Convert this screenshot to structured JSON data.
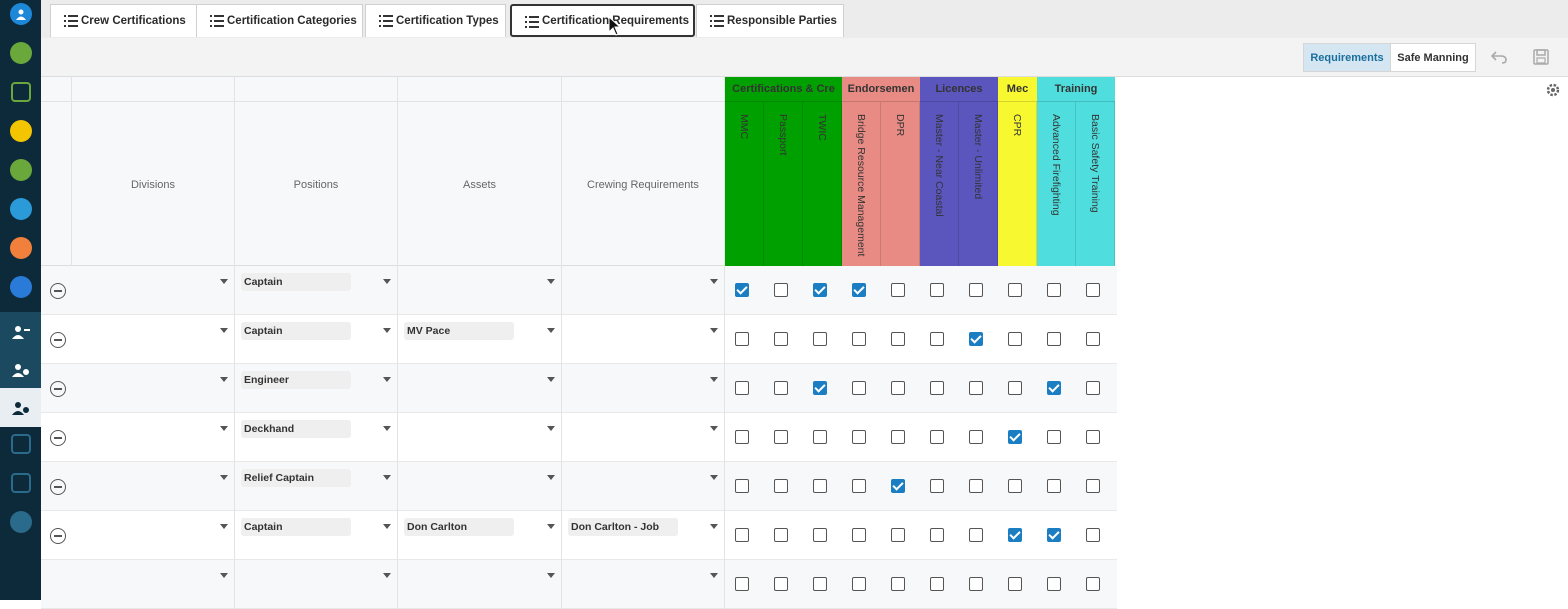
{
  "tabs": [
    {
      "label": "Crew Certifications"
    },
    {
      "label": "Certification Categories"
    },
    {
      "label": "Certification Types"
    },
    {
      "label": "Certification Requirements"
    },
    {
      "label": "Responsible Parties"
    }
  ],
  "toolbar": {
    "requirements_label": "Requirements",
    "safe_manning_label": "Safe Manning"
  },
  "columns": {
    "divisions": "Divisions",
    "positions": "Positions",
    "assets": "Assets",
    "crewing": "Crewing Requirements"
  },
  "groups": [
    {
      "title": "Certifications & Cre",
      "color": "#00a000",
      "items": [
        "MMC",
        "Passport",
        "TWIC"
      ]
    },
    {
      "title": "Endorsemen",
      "color": "#e98b85",
      "items": [
        "Bridge Resource Management",
        "DPR"
      ]
    },
    {
      "title": "Licences",
      "color": "#5b55be",
      "items": [
        "Master - Near Coastal",
        "Master - Unlimited"
      ]
    },
    {
      "title": "Mec",
      "color": "#f8f830",
      "items": [
        "CPR"
      ]
    },
    {
      "title": "Training",
      "color": "#4fdedd",
      "items": [
        "Advanced Firefighting",
        "Basic Safety Training"
      ]
    }
  ],
  "rows": [
    {
      "division": "",
      "position": "Captain",
      "asset": "",
      "crewing": "",
      "checks": [
        true,
        false,
        true,
        true,
        false,
        false,
        false,
        false,
        false,
        false
      ]
    },
    {
      "division": "",
      "position": "Captain",
      "asset": "MV Pace",
      "crewing": "",
      "checks": [
        false,
        false,
        false,
        false,
        false,
        false,
        true,
        false,
        false,
        false
      ]
    },
    {
      "division": "",
      "position": "Engineer",
      "asset": "",
      "crewing": "",
      "checks": [
        false,
        false,
        true,
        false,
        false,
        false,
        false,
        false,
        true,
        false
      ]
    },
    {
      "division": "",
      "position": "Deckhand",
      "asset": "",
      "crewing": "",
      "checks": [
        false,
        false,
        false,
        false,
        false,
        false,
        false,
        true,
        false,
        false
      ]
    },
    {
      "division": "",
      "position": "Relief Captain",
      "asset": "",
      "crewing": "",
      "checks": [
        false,
        false,
        false,
        false,
        true,
        false,
        false,
        false,
        false,
        false
      ]
    },
    {
      "division": "",
      "position": "Captain",
      "asset": "Don Carlton",
      "crewing": "Don Carlton - Job",
      "checks": [
        false,
        false,
        false,
        false,
        false,
        false,
        false,
        true,
        true,
        false
      ]
    },
    {
      "division": "",
      "position": "",
      "asset": "",
      "crewing": "",
      "checks": [
        false,
        false,
        false,
        false,
        false,
        false,
        false,
        false,
        false,
        false
      ]
    }
  ]
}
